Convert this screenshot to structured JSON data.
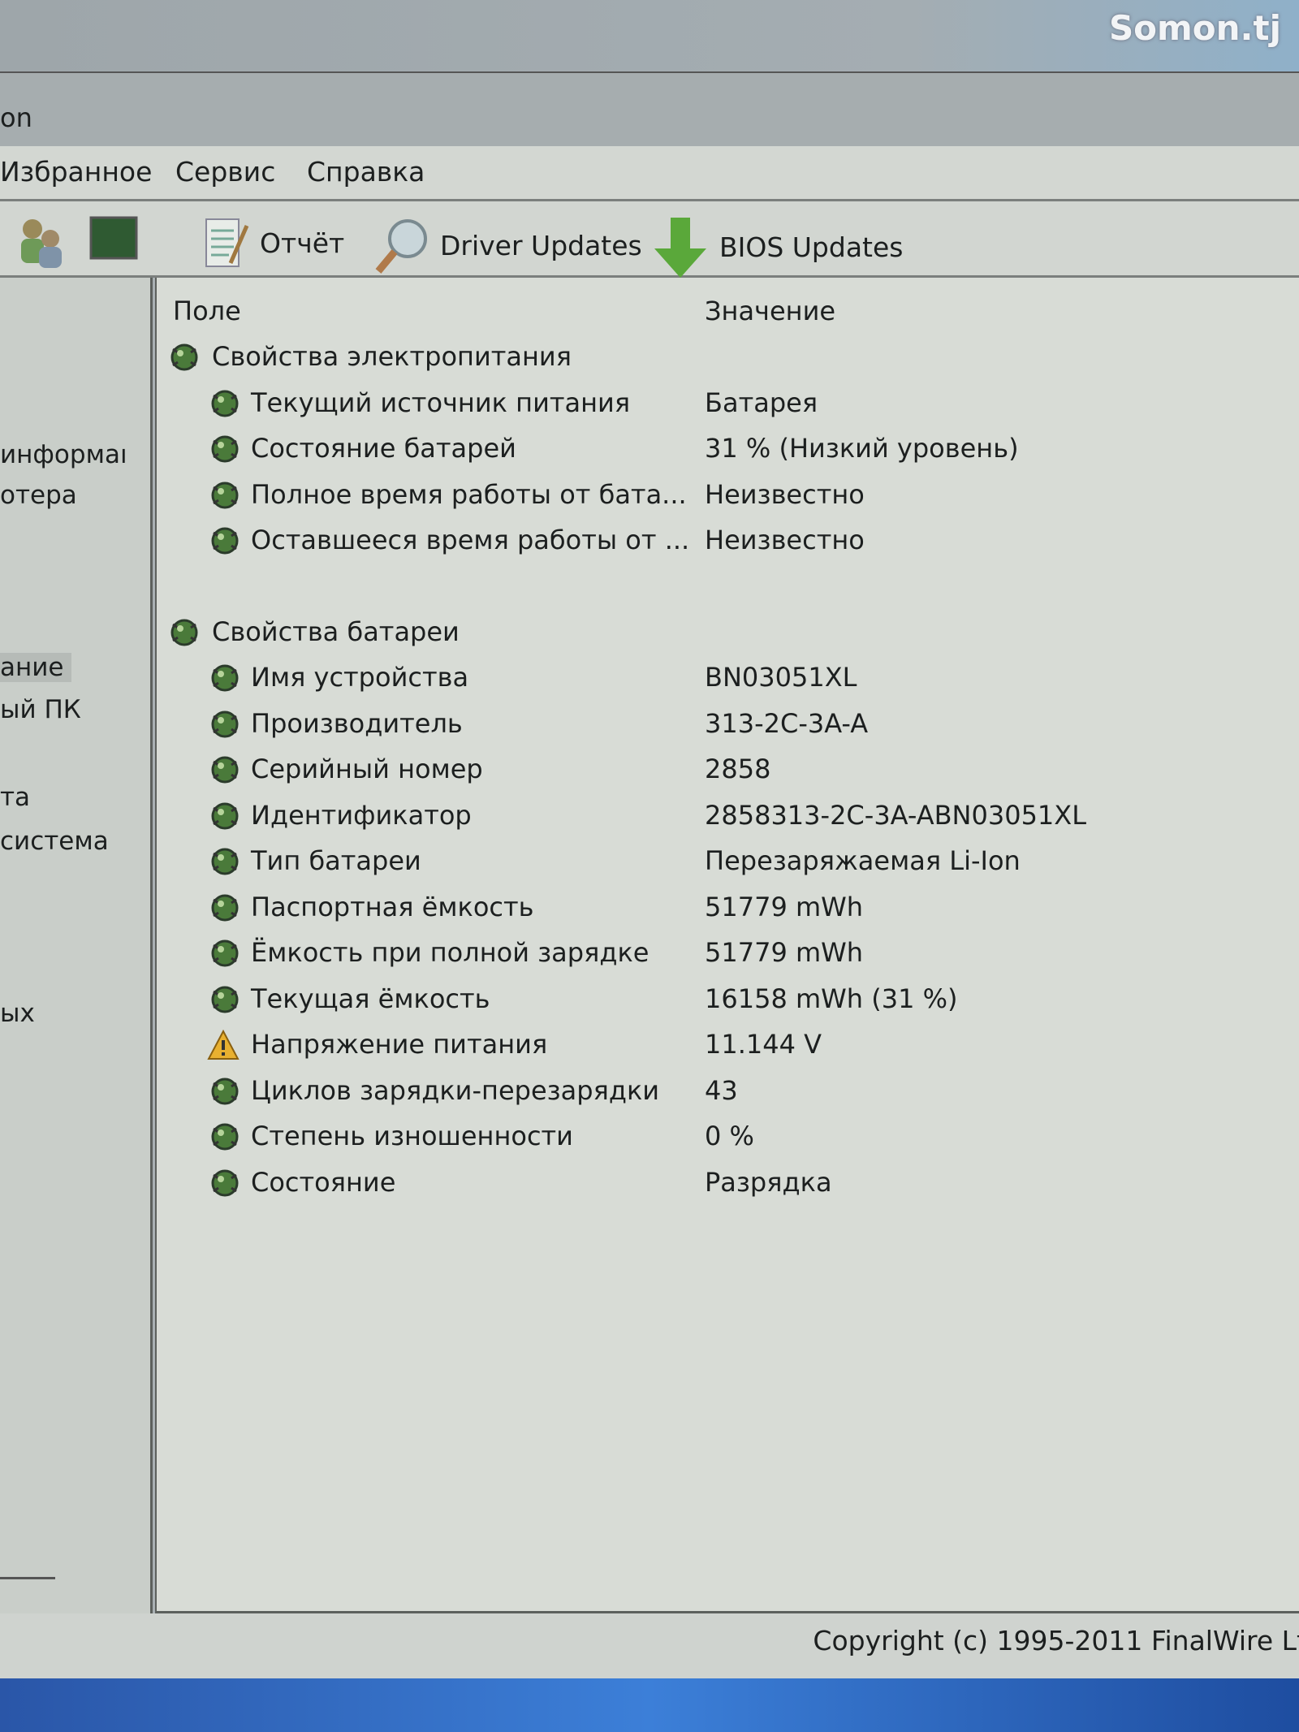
{
  "watermark": "Somon.tj",
  "window": {
    "title_fragment": "on"
  },
  "menu": [
    "Избранное",
    "Сервис",
    "Справка"
  ],
  "toolbar": {
    "report": "Отчёт",
    "driver_updates": "Driver Updates",
    "bios_updates": "BIOS Updates"
  },
  "sidebar": [
    "информаı",
    "отера",
    "ание",
    "ый ПК",
    "та",
    "система",
    "ых"
  ],
  "columns": {
    "field": "Поле",
    "value": "Значение"
  },
  "sections": [
    {
      "title": "Свойства электропитания",
      "rows": [
        {
          "field": "Текущий источник питания",
          "value": "Батарея",
          "icon": "battery-icon"
        },
        {
          "field": "Состояние батарей",
          "value": "31 % (Низкий уровень)",
          "icon": "battery-icon"
        },
        {
          "field": "Полное время работы от бата...",
          "value": "Неизвестно",
          "icon": "battery-icon"
        },
        {
          "field": "Оставшееся время работы от ...",
          "value": "Неизвестно",
          "icon": "battery-icon"
        }
      ]
    },
    {
      "title": "Свойства батареи",
      "rows": [
        {
          "field": "Имя устройства",
          "value": "BN03051XL",
          "icon": "battery-icon"
        },
        {
          "field": "Производитель",
          "value": "313-2C-3A-A",
          "icon": "battery-icon"
        },
        {
          "field": "Серийный номер",
          "value": "2858",
          "icon": "battery-icon"
        },
        {
          "field": "Идентификатор",
          "value": "2858313-2C-3A-ABN03051XL",
          "icon": "battery-icon"
        },
        {
          "field": "Тип батареи",
          "value": "Перезаряжаемая Li-Ion",
          "icon": "battery-icon"
        },
        {
          "field": "Паспортная ёмкость",
          "value": "51779 mWh",
          "icon": "battery-icon"
        },
        {
          "field": "Ёмкость при полной зарядке",
          "value": "51779 mWh",
          "icon": "battery-icon"
        },
        {
          "field": "Текущая ёмкость",
          "value": "16158 mWh  (31 %)",
          "icon": "battery-icon"
        },
        {
          "field": "Напряжение питания",
          "value": "11.144 V",
          "icon": "warning-icon"
        },
        {
          "field": "Циклов зарядки-перезарядки",
          "value": "43",
          "icon": "battery-icon"
        },
        {
          "field": "Степень изношенности",
          "value": "0 %",
          "icon": "battery-icon"
        },
        {
          "field": "Состояние",
          "value": "Разрядка",
          "icon": "battery-icon"
        }
      ]
    }
  ],
  "status": {
    "copyright": "Copyright (c) 1995-2011 FinalWire Lt"
  }
}
